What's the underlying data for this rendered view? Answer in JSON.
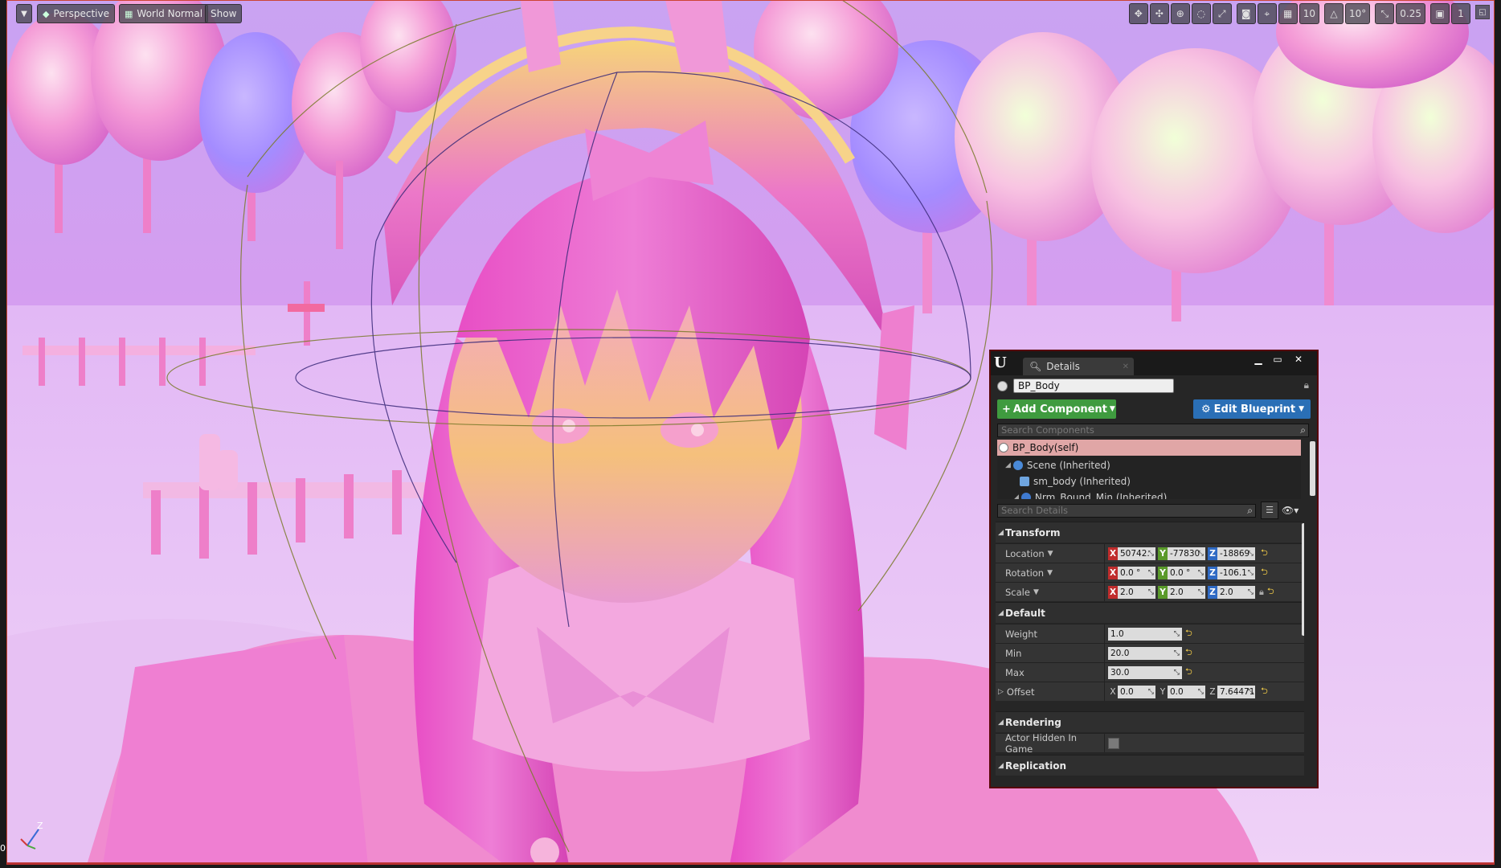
{
  "viewport": {
    "perspective_label": "Perspective",
    "view_mode_label": "World Normal",
    "show_label": "Show",
    "grid_snap_value": "10",
    "rotation_snap_value": "10°",
    "scale_snap_value": "0.25",
    "camera_speed_value": "1",
    "axis_z_label": "Z",
    "left_edge_text": "0"
  },
  "details": {
    "tab_title": "Details",
    "actor_name": "BP_Body",
    "add_component_label": "Add Component",
    "edit_blueprint_label": "Edit Blueprint",
    "search_components_placeholder": "Search Components",
    "search_details_placeholder": "Search Details",
    "components": [
      {
        "label": "BP_Body(self)"
      },
      {
        "label": "Scene (Inherited)"
      },
      {
        "label": "sm_body (Inherited)"
      },
      {
        "label": "Nrm_Bound_Min (Inherited)"
      }
    ],
    "categories": {
      "transform": "Transform",
      "default": "Default",
      "rendering": "Rendering",
      "replication": "Replication"
    },
    "transform": {
      "location_label": "Location",
      "location": {
        "x": "50742.",
        "y": "-77830",
        "z": "-18869"
      },
      "rotation_label": "Rotation",
      "rotation": {
        "x": "0.0 °",
        "y": "0.0 °",
        "z": "-106.1"
      },
      "scale_label": "Scale",
      "scale": {
        "x": "2.0",
        "y": "2.0",
        "z": "2.0"
      }
    },
    "default": {
      "weight_label": "Weight",
      "weight": "1.0",
      "min_label": "Min",
      "min": "20.0",
      "max_label": "Max",
      "max": "30.0",
      "offset_label": "Offset",
      "offset": {
        "x": "0.0",
        "y": "0.0",
        "z": "7.64471"
      }
    },
    "rendering": {
      "actor_hidden_label": "Actor Hidden In Game",
      "actor_hidden_checked": false
    },
    "axis_letters": {
      "x": "X",
      "y": "Y",
      "z": "Z"
    }
  },
  "colors": {
    "axis_x": "#c02c2c",
    "axis_y": "#5a9a2a",
    "axis_z": "#2f6ac4",
    "add_component": "#3f9b3f",
    "edit_blueprint": "#2a6fb6",
    "selected_row": "#e0a6a6"
  },
  "icons": [
    "menu-icon",
    "perspective-icon",
    "view-mode-icon",
    "translate-icon",
    "rotate-icon",
    "scale-icon",
    "grid-icon",
    "angle-icon",
    "camera-speed-icon",
    "maximize-icon",
    "unreal-logo-icon",
    "search-icon",
    "lock-icon",
    "eye-icon",
    "reset-arrow-icon"
  ]
}
